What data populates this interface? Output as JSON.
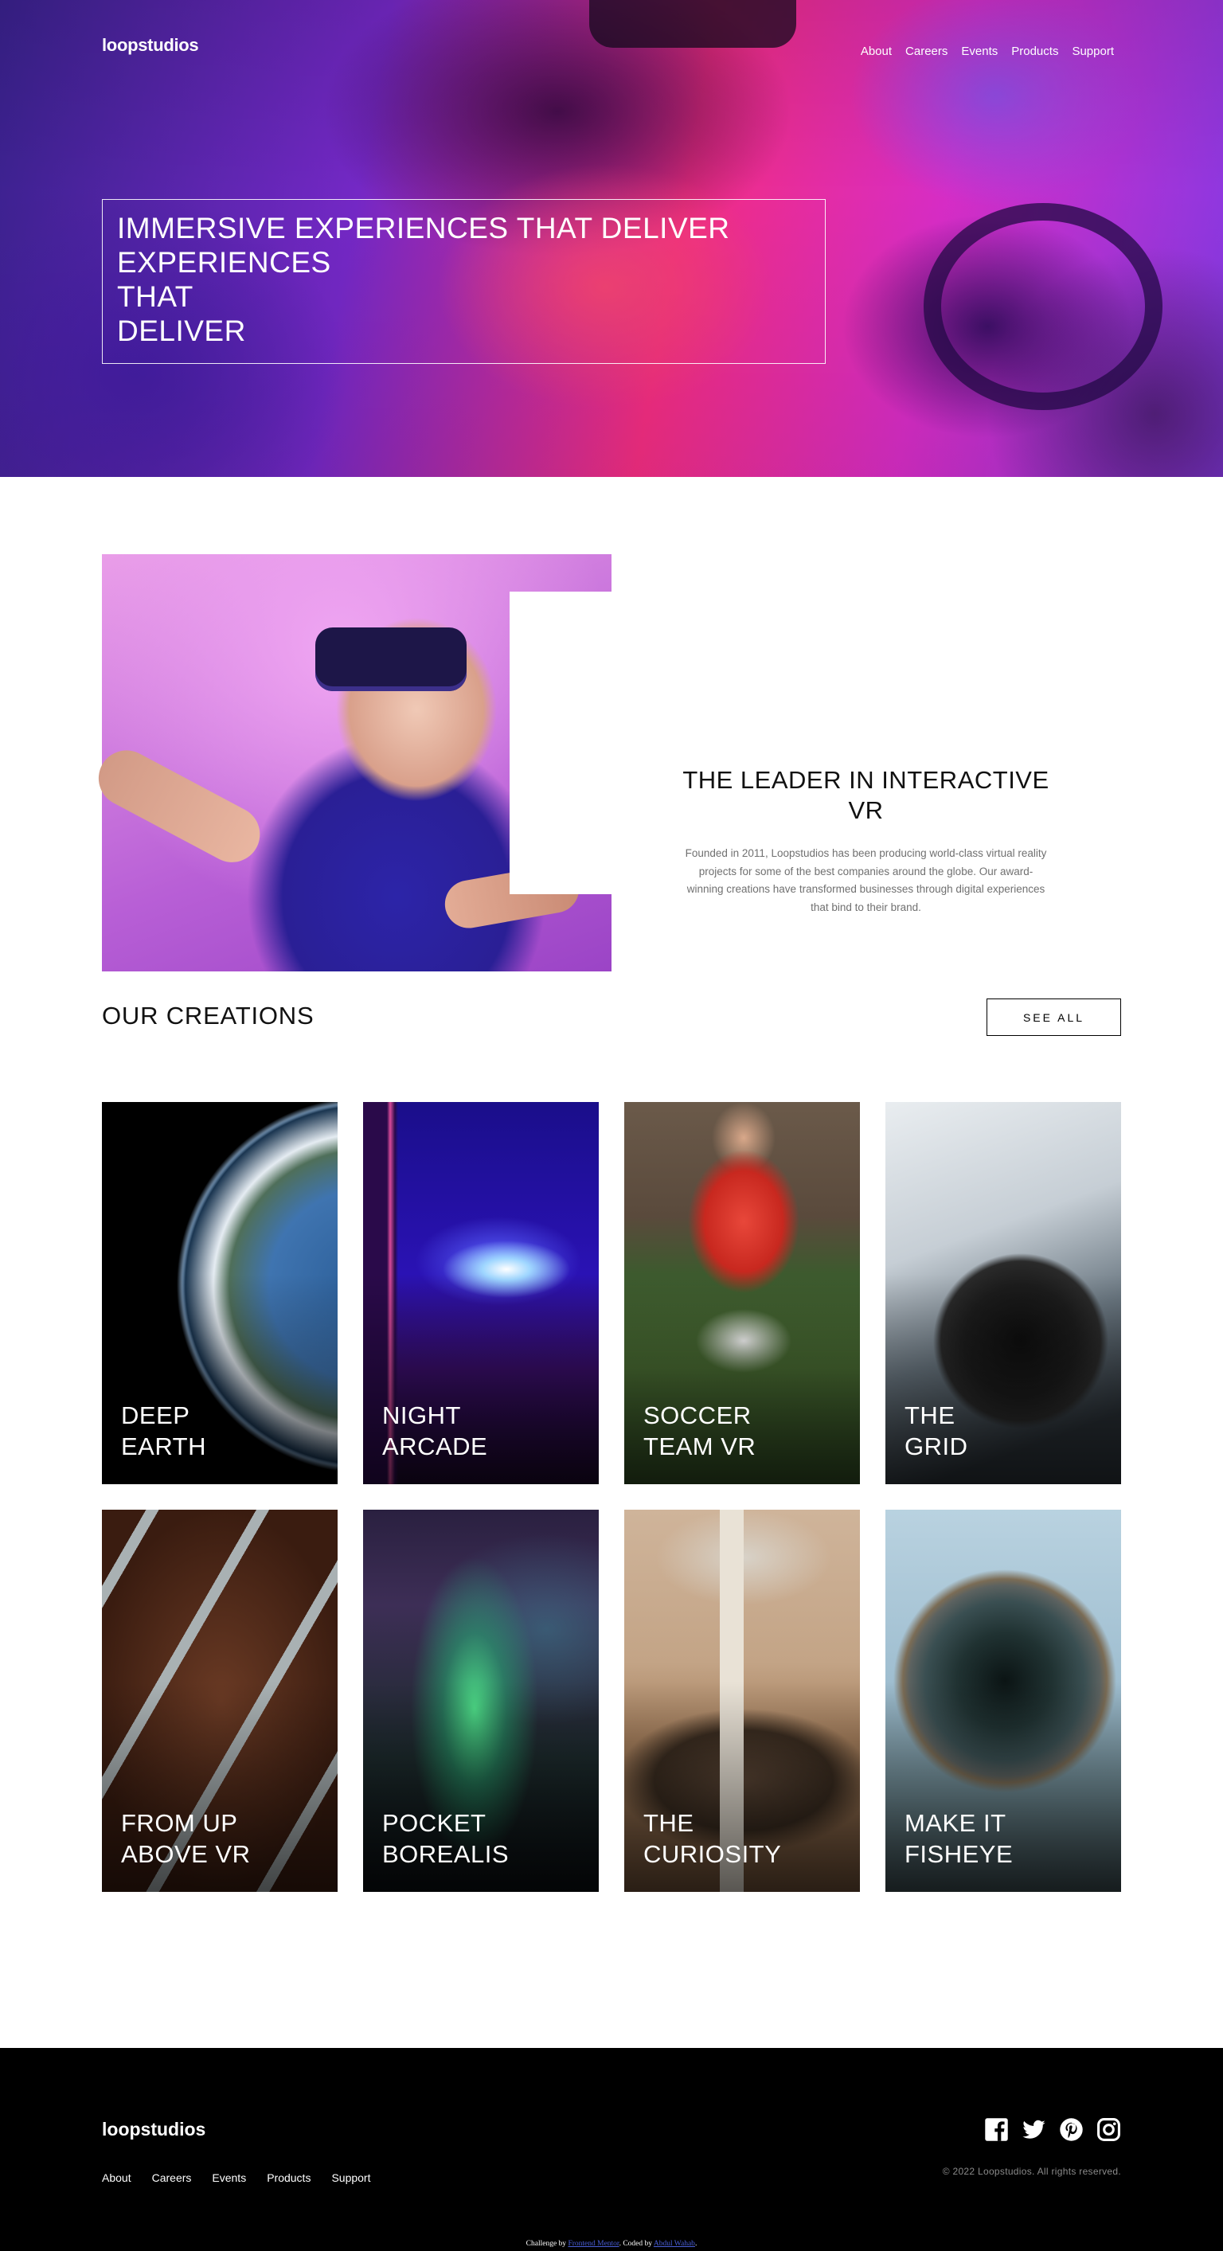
{
  "header": {
    "logo": "loopstudios",
    "nav": [
      "About",
      "Careers",
      "Events",
      "Products",
      "Support"
    ]
  },
  "hero": {
    "title_lines": [
      "IMMERSIVE EXPERIENCES THAT DELIVER",
      "EXPERIENCES",
      "THAT",
      "DELIVER"
    ]
  },
  "intro": {
    "title": "THE LEADER IN INTERACTIVE VR",
    "body": "Founded in 2011, Loopstudios has been producing world-class virtual reality projects for some of the best companies around the globe. Our award-winning creations have transformed businesses through digital experiences that bind to their brand."
  },
  "creations": {
    "title": "OUR CREATIONS",
    "see_all": "SEE ALL",
    "items": [
      {
        "title": "DEEP\nEARTH"
      },
      {
        "title": "NIGHT\nARCADE"
      },
      {
        "title": "SOCCER\nTEAM VR"
      },
      {
        "title": "THE\nGRID"
      },
      {
        "title": "FROM UP\nABOVE VR"
      },
      {
        "title": "POCKET\nBOREALIS"
      },
      {
        "title": "THE\nCURIOSITY"
      },
      {
        "title": "MAKE IT\nFISHEYE"
      }
    ]
  },
  "footer": {
    "logo": "loopstudios",
    "nav": [
      "About",
      "Careers",
      "Events",
      "Products",
      "Support"
    ],
    "socials": [
      "facebook-icon",
      "twitter-icon",
      "pinterest-icon",
      "instagram-icon"
    ],
    "copyright": "© 2022 Loopstudios. All rights reserved.",
    "attribution": {
      "prefix": "Challenge by ",
      "link1": "Frontend Mentor",
      "middle": ". Coded by ",
      "link2": "Abdul Wahab",
      "suffix": "."
    }
  }
}
